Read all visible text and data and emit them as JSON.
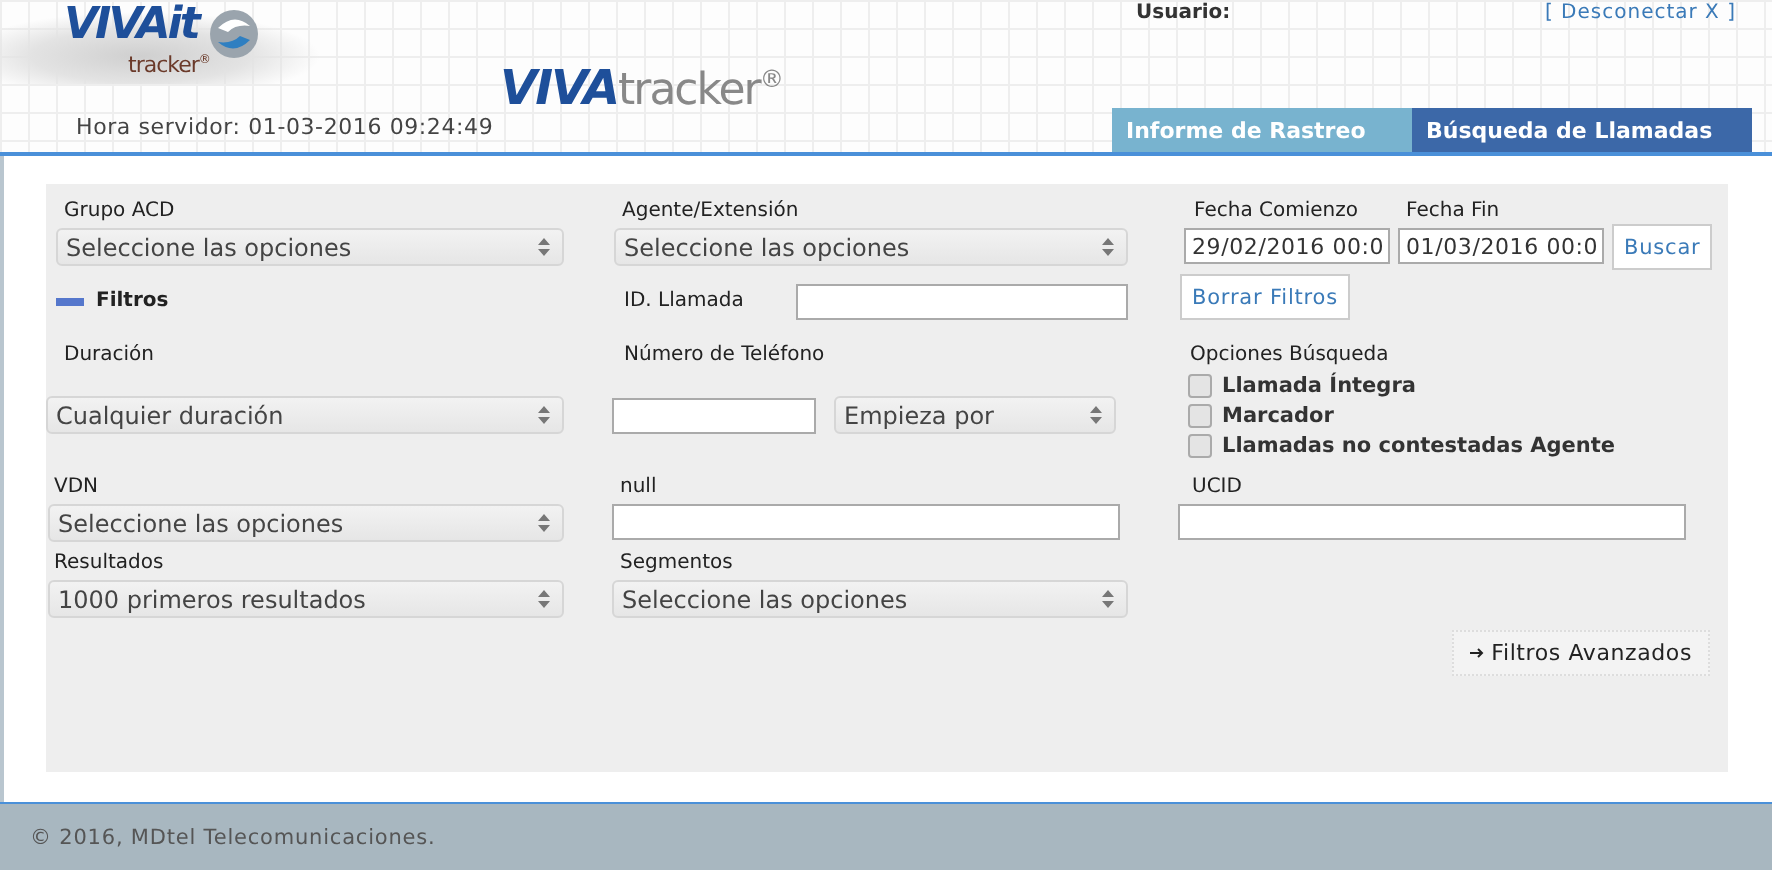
{
  "header": {
    "logo_main": "VIVAit",
    "logo_sub": "tracker$^{®}$",
    "brand_bold": "VIVA",
    "brand_light": "tracker$^{®}$",
    "server_time": "Hora servidor: 01-03-2016 09:24:49",
    "user_label": "Usuario:",
    "logout": "[ Desconectar X ]"
  },
  "tabs": [
    {
      "label": "Informe de Rastreo",
      "selected": false
    },
    {
      "label": "Búsqueda de Llamadas",
      "selected": true
    }
  ],
  "form": {
    "grupo_acd": {
      "label": "Grupo ACD",
      "value": "Seleccione las opciones"
    },
    "agente": {
      "label": "Agente/Extensión",
      "value": "Seleccione las opciones"
    },
    "fecha_comienzo": {
      "label": "Fecha Comienzo",
      "value": "29/02/2016 00:0"
    },
    "fecha_fin": {
      "label": "Fecha Fin",
      "value": "01/03/2016 00:0"
    },
    "search_button": "Buscar",
    "clear_button": "Borrar Filtros",
    "filters": {
      "label": "Filtros",
      "expanded": true
    },
    "id_llamada": {
      "label": "ID. Llamada"
    },
    "duracion": {
      "label": "Duración",
      "value": "Cualquier duración"
    },
    "telefono": {
      "label": "Número de Teléfono",
      "match": "Empieza por"
    },
    "opciones": {
      "label": "Opciones Búsqueda",
      "items": [
        {
          "label": "Llamada Íntegra",
          "checked": false
        },
        {
          "label": "Marcador",
          "checked": false
        },
        {
          "label": "Llamadas no contestadas Agente",
          "checked": false
        }
      ]
    },
    "vdn": {
      "label": "VDN",
      "value": "Seleccione las opciones"
    },
    "null_field": {
      "label": "null"
    },
    "ucid": {
      "label": "UCID"
    },
    "resultados": {
      "label": "Resultados",
      "value": "1000 primeros resultados"
    },
    "segmentos": {
      "label": "Segmentos",
      "value": "Seleccione las opciones"
    },
    "advanced_button": "Filtros Avanzados"
  },
  "footer": "© 2016, MDtel Telecomunicaciones."
}
